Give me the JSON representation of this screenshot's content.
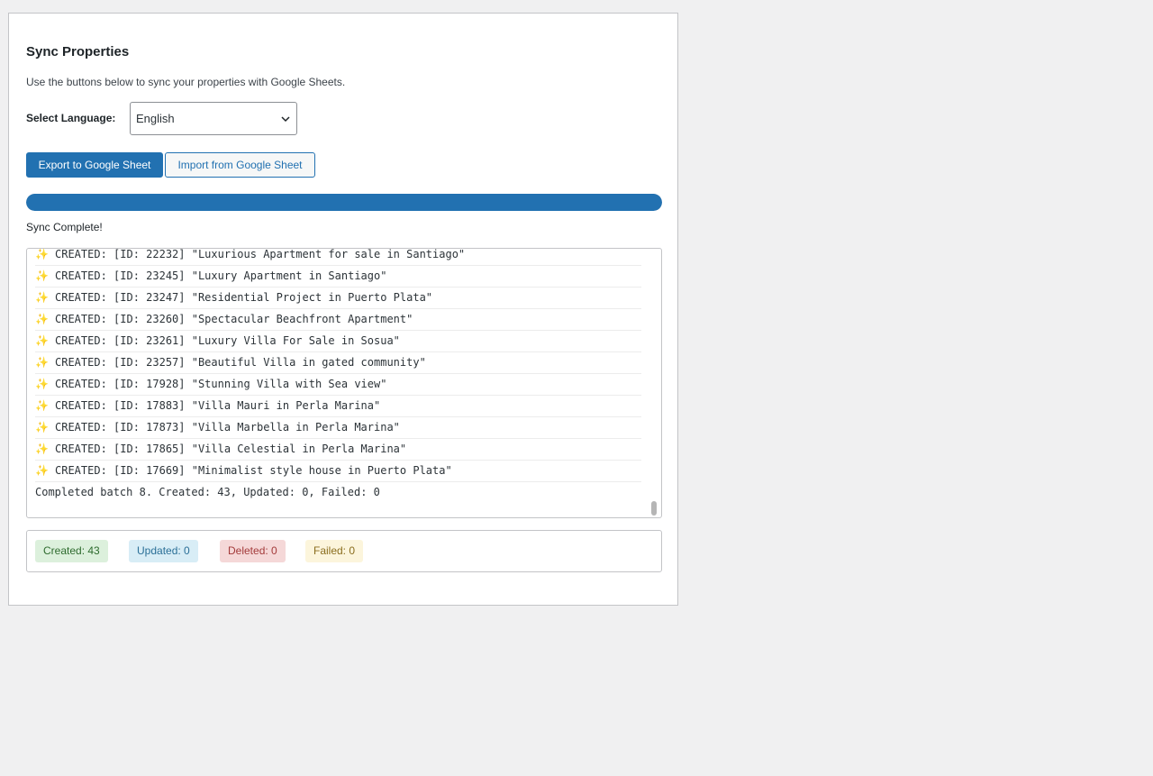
{
  "panel": {
    "title": "Sync Properties",
    "description": "Use the buttons below to sync your properties with Google Sheets."
  },
  "language": {
    "label": "Select Language:",
    "selected": "English"
  },
  "buttons": {
    "export_label": "Export to Google Sheet",
    "import_label": "Import from Google Sheet"
  },
  "progress": {
    "percent": 100,
    "status_text": "Sync Complete!"
  },
  "log": {
    "icon": "sparkles-icon",
    "entries": [
      "CREATED: [ID: 22232] \"Luxurious Apartment for sale in Santiago\"",
      "CREATED: [ID: 23245] \"Luxury Apartment in Santiago\"",
      "CREATED: [ID: 23247] \"Residential Project in Puerto Plata\"",
      "CREATED: [ID: 23260] \"Spectacular Beachfront Apartment\"",
      "CREATED: [ID: 23261] \"Luxury Villa For Sale in Sosua\"",
      "CREATED: [ID: 23257] \"Beautiful Villa in gated community\"",
      "CREATED: [ID: 17928] \"Stunning Villa with Sea view\"",
      "CREATED: [ID: 17883] \"Villa Mauri in Perla Marina\"",
      "CREATED: [ID: 17873] \"Villa Marbella in Perla Marina\"",
      "CREATED: [ID: 17865] \"Villa Celestial in Perla Marina\"",
      "CREATED: [ID: 17669] \"Minimalist style house in Puerto Plata\""
    ],
    "summary": "Completed batch 8. Created: 43, Updated: 0, Failed: 0"
  },
  "stats": {
    "created": "Created: 43",
    "updated": "Updated: 0",
    "deleted": "Deleted: 0",
    "failed": "Failed: 0"
  },
  "colors": {
    "accent": "#2271b1",
    "created_bg": "#dcf0dc",
    "updated_bg": "#d8edf6",
    "deleted_bg": "#f5d8d8",
    "failed_bg": "#fcf5dc"
  }
}
